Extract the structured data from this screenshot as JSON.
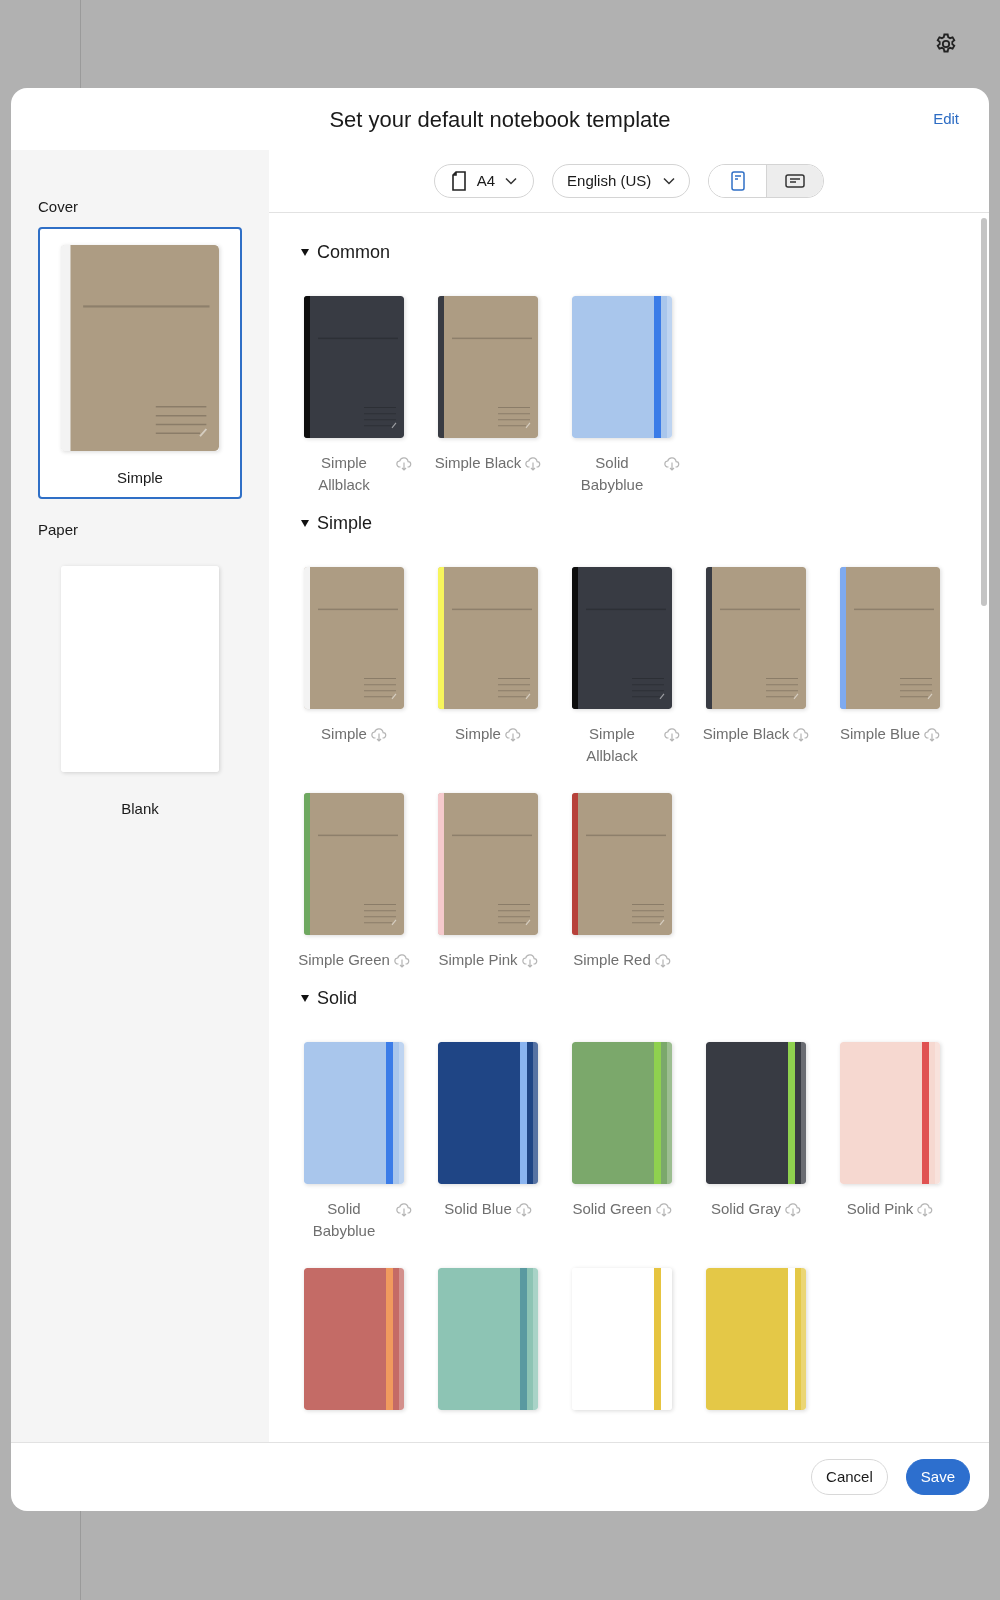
{
  "dialog": {
    "title": "Set your default notebook template",
    "edit_link": "Edit"
  },
  "sidebar": {
    "sections": [
      {
        "title": "Cover",
        "item": {
          "name": "Simple",
          "selected": true,
          "cover": {
            "kind": "simple",
            "color": "#ad9c83",
            "spine": {
              "color": "#f3f3f3"
            }
          }
        }
      },
      {
        "title": "Paper",
        "item": {
          "name": "Blank",
          "selected": false,
          "cover": {
            "kind": "blank",
            "color": "#ffffff"
          }
        }
      }
    ]
  },
  "toolbar": {
    "size": "A4",
    "language": "English (US)",
    "orientation": [
      {
        "kind": "portrait",
        "selected": true
      },
      {
        "kind": "landscape",
        "selected": false
      }
    ]
  },
  "sections": [
    {
      "title": "Common",
      "expanded": true,
      "templates": [
        {
          "name": "Simple Allblack",
          "cover": {
            "kind": "simple",
            "color": "#383b43",
            "spine": {
              "color": "#0d0d0d"
            }
          }
        },
        {
          "name": "Simple Black",
          "cover": {
            "kind": "simple",
            "color": "#ad9c83",
            "spine": {
              "color": "#383b43"
            }
          }
        },
        {
          "name": "Solid Babyblue",
          "cover": {
            "kind": "solid",
            "color": "#a9c6ec",
            "spine": {
              "color": "#3b7ce8"
            }
          }
        }
      ]
    },
    {
      "title": "Simple",
      "expanded": true,
      "templates": [
        {
          "name": "Simple",
          "cover": {
            "kind": "simple",
            "color": "#ad9c83",
            "spine": {
              "color": "#f3f3f3"
            }
          }
        },
        {
          "name": "Simple",
          "cover": {
            "kind": "simple",
            "color": "#ad9c83",
            "spine": {
              "color": "#f7f55c"
            }
          }
        },
        {
          "name": "Simple Allblack",
          "cover": {
            "kind": "simple",
            "color": "#383b43",
            "spine": {
              "color": "#0d0d0d"
            }
          }
        },
        {
          "name": "Simple Black",
          "cover": {
            "kind": "simple",
            "color": "#ad9c83",
            "spine": {
              "color": "#383b43"
            }
          }
        },
        {
          "name": "Simple Blue",
          "cover": {
            "kind": "simple",
            "color": "#ad9c83",
            "spine": {
              "color": "#7eaaf0"
            }
          }
        },
        {
          "name": "Simple Green",
          "cover": {
            "kind": "simple",
            "color": "#ad9c83",
            "spine": {
              "color": "#6ea860"
            }
          }
        },
        {
          "name": "Simple Pink",
          "cover": {
            "kind": "simple",
            "color": "#ad9c83",
            "spine": {
              "color": "#f5c9cc"
            }
          }
        },
        {
          "name": "Simple Red",
          "cover": {
            "kind": "simple",
            "color": "#ad9c83",
            "spine": {
              "color": "#b7413a"
            }
          }
        }
      ]
    },
    {
      "title": "Solid",
      "expanded": true,
      "templates": [
        {
          "name": "Solid Babyblue",
          "cover": {
            "kind": "solid",
            "color": "#a9c6ec",
            "spine": {
              "color": "#3b7ce8"
            }
          }
        },
        {
          "name": "Solid Blue",
          "cover": {
            "kind": "solid",
            "color": "#1f4585",
            "spine": {
              "color": "#8ab4f0"
            }
          }
        },
        {
          "name": "Solid Green",
          "cover": {
            "kind": "solid",
            "color": "#7ba86b",
            "spine": {
              "color": "#8fd14f"
            }
          }
        },
        {
          "name": "Solid Gray",
          "cover": {
            "kind": "solid",
            "color": "#383b43",
            "spine": {
              "color": "#8fd14f"
            }
          }
        },
        {
          "name": "Solid Pink",
          "cover": {
            "kind": "solid",
            "color": "#f6d8d0",
            "spine": {
              "color": "#e05252"
            }
          }
        },
        {
          "cover": {
            "kind": "solid",
            "color": "#c46b66",
            "spine": {
              "color": "#f09a5e"
            }
          }
        },
        {
          "cover": {
            "kind": "solid",
            "color": "#8dc4b4",
            "spine": {
              "color": "#5a9aa0"
            }
          }
        },
        {
          "cover": {
            "kind": "solid",
            "color": "#ffffff",
            "spine": {
              "color": "#e6c440"
            }
          }
        },
        {
          "cover": {
            "kind": "solid",
            "color": "#e4c847",
            "spine": {
              "color": "#ffffff"
            }
          }
        }
      ]
    }
  ],
  "footer": {
    "buttons": [
      {
        "label": "Cancel",
        "kind": "secondary"
      },
      {
        "label": "Save",
        "kind": "primary"
      }
    ]
  }
}
